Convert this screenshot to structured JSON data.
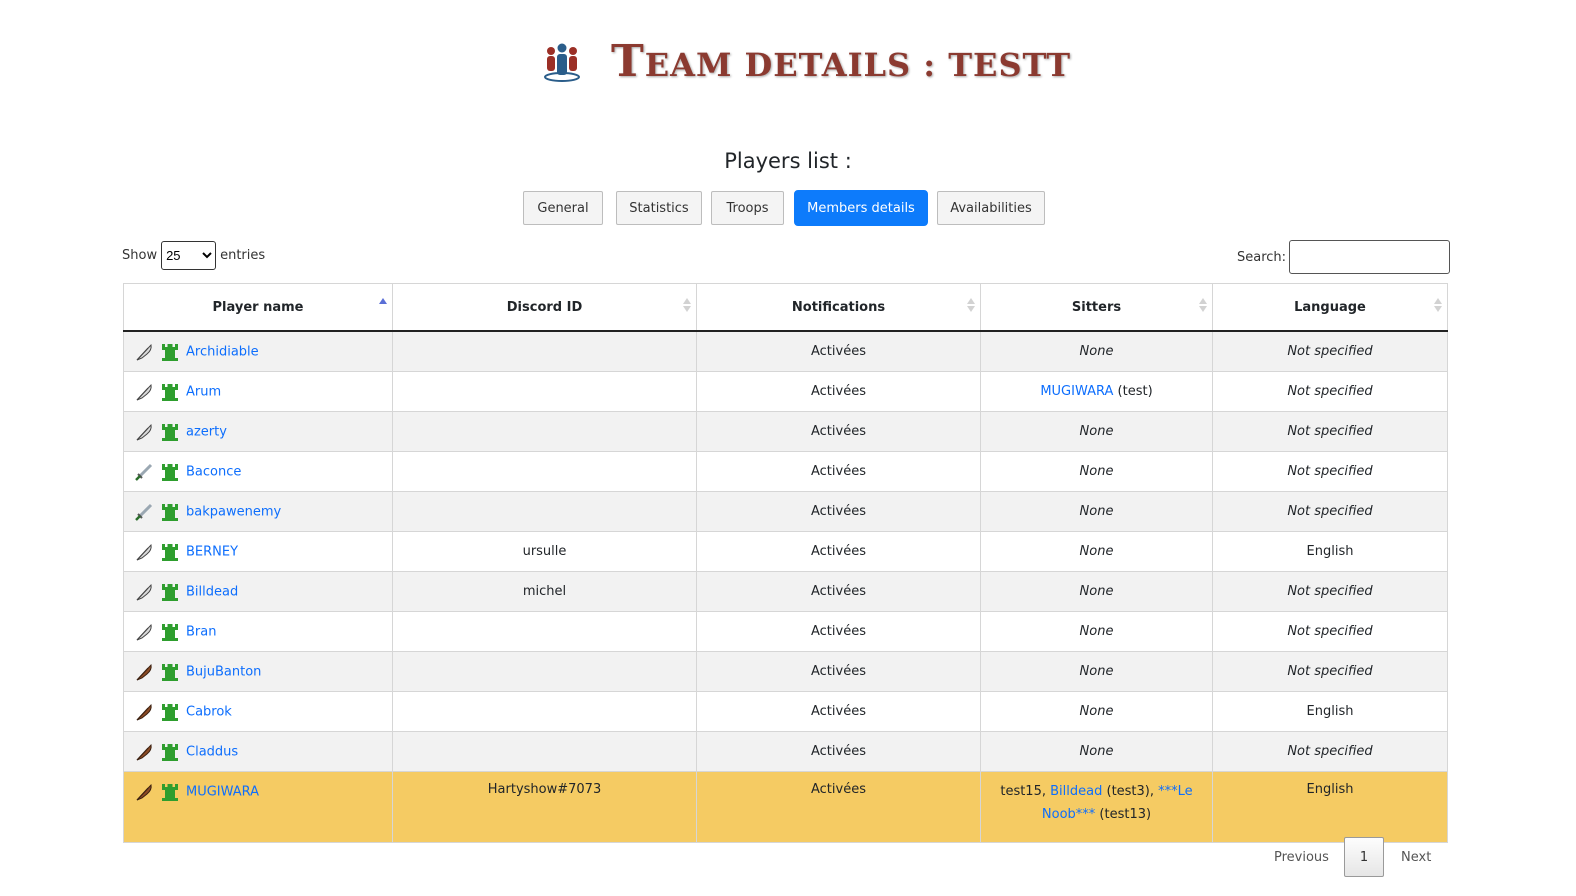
{
  "header": {
    "title_initial": "T",
    "title_rest": "EAM DETAILS : TESTT",
    "logo_icon": "team-icon"
  },
  "players_label": "Players list :",
  "tabs": [
    {
      "label": "General",
      "active": false
    },
    {
      "label": "Statistics",
      "active": false
    },
    {
      "label": "Troops",
      "active": false
    },
    {
      "label": "Members details",
      "active": true
    },
    {
      "label": "Availabilities",
      "active": false
    }
  ],
  "length": {
    "show": "Show",
    "value": "25",
    "entries": "entries"
  },
  "search": {
    "label": "Search:",
    "value": ""
  },
  "table": {
    "headers": [
      "Player name",
      "Discord ID",
      "Notifications",
      "Sitters",
      "Language"
    ],
    "sorted_column": "Player name",
    "rows": [
      {
        "rank_icon": "feather-gray",
        "name": "Archidiable",
        "discord": "",
        "notif": "Activées",
        "sitters": "None",
        "language": "Not specified"
      },
      {
        "rank_icon": "feather-gray",
        "name": "Arum",
        "discord": "",
        "notif": "Activées",
        "sitter_link": "MUGIWARA",
        "sitter_rest": " (test)",
        "language": "Not specified"
      },
      {
        "rank_icon": "feather-gray",
        "name": "azerty",
        "discord": "",
        "notif": "Activées",
        "sitters": "None",
        "language": "Not specified"
      },
      {
        "rank_icon": "sword",
        "name": "Baconce",
        "discord": "",
        "notif": "Activées",
        "sitters": "None",
        "language": "Not specified"
      },
      {
        "rank_icon": "sword",
        "name": "bakpawenemy",
        "discord": "",
        "notif": "Activées",
        "sitters": "None",
        "language": "Not specified"
      },
      {
        "rank_icon": "feather-gray",
        "name": "BERNEY",
        "discord": "ursulle",
        "notif": "Activées",
        "sitters": "None",
        "language": "English"
      },
      {
        "rank_icon": "feather-gray",
        "name": "Billdead",
        "discord": "michel",
        "notif": "Activées",
        "sitters": "None",
        "language": "Not specified"
      },
      {
        "rank_icon": "feather-gray",
        "name": "Bran",
        "discord": "",
        "notif": "Activées",
        "sitters": "None",
        "language": "Not specified"
      },
      {
        "rank_icon": "feather-brown",
        "name": "BujuBanton",
        "discord": "",
        "notif": "Activées",
        "sitters": "None",
        "language": "Not specified"
      },
      {
        "rank_icon": "feather-brown",
        "name": "Cabrok",
        "discord": "",
        "notif": "Activées",
        "sitters": "None",
        "language": "English"
      },
      {
        "rank_icon": "feather-brown",
        "name": "Claddus",
        "discord": "",
        "notif": "Activées",
        "sitters": "None",
        "language": "Not specified"
      }
    ],
    "highlight_row": {
      "rank_icon": "feather-brown",
      "name": "MUGIWARA",
      "discord": "Hartyshow#7073",
      "notif": "Activées",
      "s1": "test15, ",
      "s2_link": "Billdead",
      "s3": " (test3), ",
      "s4_link": "***Le Noob***",
      "s5": " (test13)",
      "language": "English"
    },
    "highlight_color": "#f5cb63"
  },
  "pagination": {
    "previous": "Previous",
    "page": "1",
    "next": "Next"
  }
}
